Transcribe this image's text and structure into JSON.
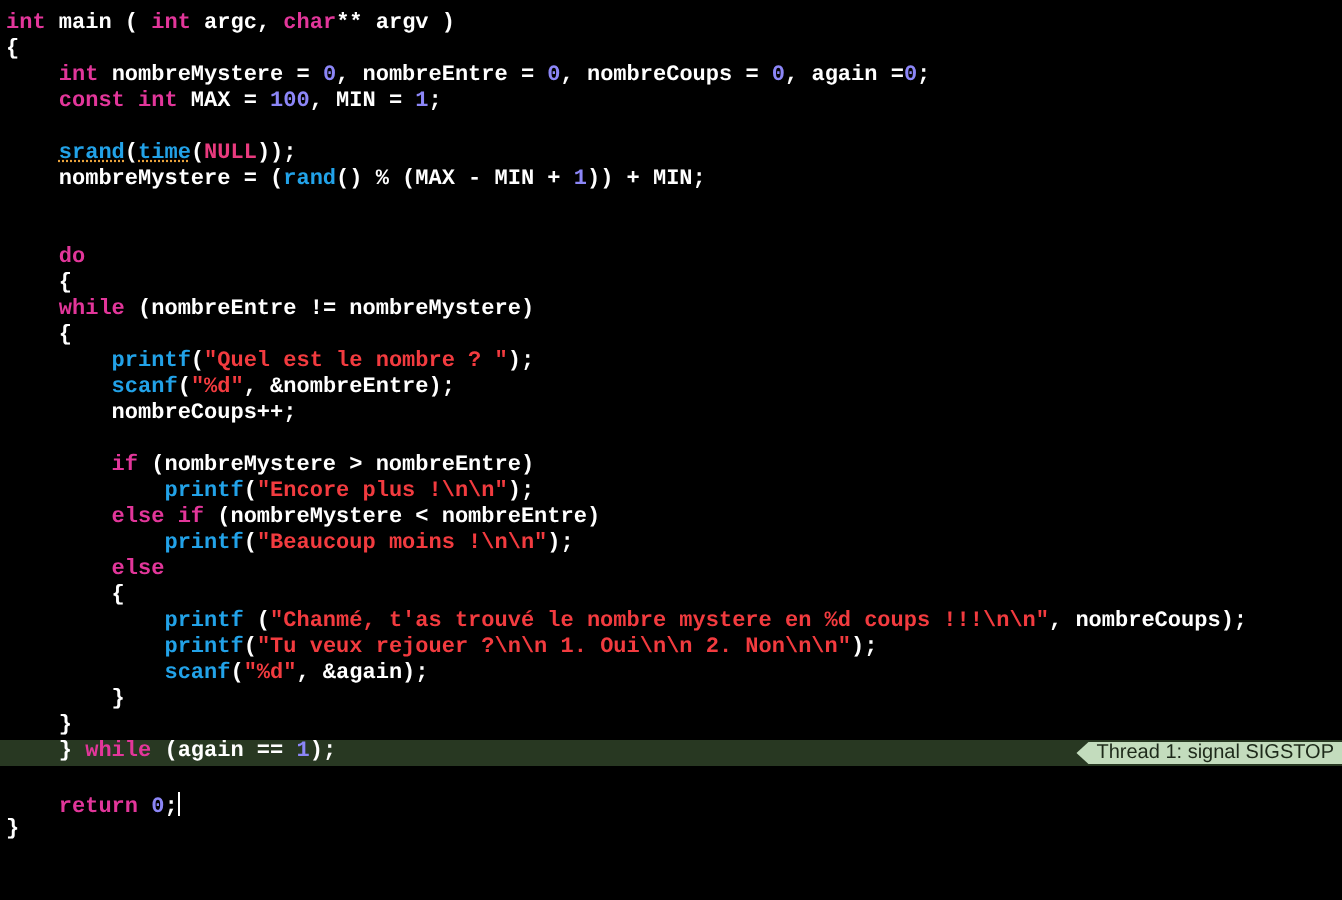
{
  "editor": {
    "lines": [
      {
        "current": false,
        "caret": false,
        "tokens": [
          {
            "kind": "keyword",
            "text": "int"
          },
          {
            "kind": "plain",
            "text": " main ( "
          },
          {
            "kind": "keyword",
            "text": "int"
          },
          {
            "kind": "plain",
            "text": " argc, "
          },
          {
            "kind": "keyword",
            "text": "char"
          },
          {
            "kind": "plain",
            "text": "** argv )"
          }
        ]
      },
      {
        "current": false,
        "caret": false,
        "tokens": [
          {
            "kind": "plain",
            "text": "{"
          }
        ]
      },
      {
        "current": false,
        "caret": false,
        "tokens": [
          {
            "kind": "keyword",
            "text": "    int"
          },
          {
            "kind": "plain",
            "text": " nombreMystere = "
          },
          {
            "kind": "number",
            "text": "0"
          },
          {
            "kind": "plain",
            "text": ", nombreEntre = "
          },
          {
            "kind": "number",
            "text": "0"
          },
          {
            "kind": "plain",
            "text": ", nombreCoups = "
          },
          {
            "kind": "number",
            "text": "0"
          },
          {
            "kind": "plain",
            "text": ", again ="
          },
          {
            "kind": "number",
            "text": "0"
          },
          {
            "kind": "plain",
            "text": ";"
          }
        ]
      },
      {
        "current": false,
        "caret": false,
        "tokens": [
          {
            "kind": "keyword",
            "text": "    const int"
          },
          {
            "kind": "plain",
            "text": " MAX = "
          },
          {
            "kind": "number",
            "text": "100"
          },
          {
            "kind": "plain",
            "text": ", MIN = "
          },
          {
            "kind": "number",
            "text": "1"
          },
          {
            "kind": "plain",
            "text": ";"
          }
        ]
      },
      {
        "current": false,
        "caret": false
      },
      {
        "current": false,
        "caret": false,
        "tokens": [
          {
            "kind": "function",
            "text": "    srand",
            "warning": true
          },
          {
            "kind": "plain",
            "text": "("
          },
          {
            "kind": "function",
            "text": "time",
            "warning": true
          },
          {
            "kind": "plain",
            "text": "("
          },
          {
            "kind": "macro",
            "text": "NULL"
          },
          {
            "kind": "plain",
            "text": "));"
          }
        ]
      },
      {
        "current": false,
        "caret": false,
        "tokens": [
          {
            "kind": "plain",
            "text": "    nombreMystere = ("
          },
          {
            "kind": "function",
            "text": "rand"
          },
          {
            "kind": "plain",
            "text": "() % (MAX - MIN + "
          },
          {
            "kind": "number",
            "text": "1"
          },
          {
            "kind": "plain",
            "text": ")) + MIN;"
          }
        ]
      },
      {
        "current": false,
        "caret": false
      },
      {
        "current": false,
        "caret": false
      },
      {
        "current": false,
        "caret": false,
        "tokens": [
          {
            "kind": "keyword",
            "text": "    do"
          }
        ]
      },
      {
        "current": false,
        "caret": false,
        "tokens": [
          {
            "kind": "plain",
            "text": "    {"
          }
        ]
      },
      {
        "current": false,
        "caret": false,
        "tokens": [
          {
            "kind": "keyword",
            "text": "    while"
          },
          {
            "kind": "plain",
            "text": " (nombreEntre != nombreMystere)"
          }
        ]
      },
      {
        "current": false,
        "caret": false,
        "tokens": [
          {
            "kind": "plain",
            "text": "    {"
          }
        ]
      },
      {
        "current": false,
        "caret": false,
        "tokens": [
          {
            "kind": "function",
            "text": "        printf"
          },
          {
            "kind": "plain",
            "text": "("
          },
          {
            "kind": "string",
            "text": "\"Quel est le nombre ? \""
          },
          {
            "kind": "plain",
            "text": ");"
          }
        ]
      },
      {
        "current": false,
        "caret": false,
        "tokens": [
          {
            "kind": "function",
            "text": "        scanf"
          },
          {
            "kind": "plain",
            "text": "("
          },
          {
            "kind": "string",
            "text": "\"%d\""
          },
          {
            "kind": "plain",
            "text": ", &nombreEntre);"
          }
        ]
      },
      {
        "current": false,
        "caret": false,
        "tokens": [
          {
            "kind": "plain",
            "text": "        nombreCoups++;"
          }
        ]
      },
      {
        "current": false,
        "caret": false
      },
      {
        "current": false,
        "caret": false,
        "tokens": [
          {
            "kind": "keyword",
            "text": "        if"
          },
          {
            "kind": "plain",
            "text": " (nombreMystere > nombreEntre)"
          }
        ]
      },
      {
        "current": false,
        "caret": false,
        "tokens": [
          {
            "kind": "function",
            "text": "            printf"
          },
          {
            "kind": "plain",
            "text": "("
          },
          {
            "kind": "string",
            "text": "\"Encore plus !\\n\\n\""
          },
          {
            "kind": "plain",
            "text": ");"
          }
        ]
      },
      {
        "current": false,
        "caret": false,
        "tokens": [
          {
            "kind": "keyword",
            "text": "        else if"
          },
          {
            "kind": "plain",
            "text": " (nombreMystere < nombreEntre)"
          }
        ]
      },
      {
        "current": false,
        "caret": false,
        "tokens": [
          {
            "kind": "function",
            "text": "            printf"
          },
          {
            "kind": "plain",
            "text": "("
          },
          {
            "kind": "string",
            "text": "\"Beaucoup moins !\\n\\n\""
          },
          {
            "kind": "plain",
            "text": ");"
          }
        ]
      },
      {
        "current": false,
        "caret": false,
        "tokens": [
          {
            "kind": "keyword",
            "text": "        else"
          }
        ]
      },
      {
        "current": false,
        "caret": false,
        "tokens": [
          {
            "kind": "plain",
            "text": "        {"
          }
        ]
      },
      {
        "current": false,
        "caret": false,
        "tokens": [
          {
            "kind": "function",
            "text": "            printf"
          },
          {
            "kind": "plain",
            "text": " ("
          },
          {
            "kind": "string",
            "text": "\"Chanmé, t'as trouvé le nombre mystere en %d coups !!!\\n\\n\""
          },
          {
            "kind": "plain",
            "text": ", nombreCoups);"
          }
        ]
      },
      {
        "current": false,
        "caret": false,
        "tokens": [
          {
            "kind": "function",
            "text": "            printf"
          },
          {
            "kind": "plain",
            "text": "("
          },
          {
            "kind": "string",
            "text": "\"Tu veux rejouer ?\\n\\n 1. Oui\\n\\n 2. Non\\n\\n\""
          },
          {
            "kind": "plain",
            "text": ");"
          }
        ]
      },
      {
        "current": false,
        "caret": false,
        "tokens": [
          {
            "kind": "function",
            "text": "            scanf"
          },
          {
            "kind": "plain",
            "text": "("
          },
          {
            "kind": "string",
            "text": "\"%d\""
          },
          {
            "kind": "plain",
            "text": ", &again);"
          }
        ]
      },
      {
        "current": false,
        "caret": false,
        "tokens": [
          {
            "kind": "plain",
            "text": "        }"
          }
        ]
      },
      {
        "current": false,
        "caret": false,
        "tokens": [
          {
            "kind": "plain",
            "text": "    }"
          }
        ]
      },
      {
        "current": true,
        "caret": false,
        "badge": "Thread 1: signal SIGSTOP",
        "tokens": [
          {
            "kind": "plain",
            "text": "    } "
          },
          {
            "kind": "keyword",
            "text": "while"
          },
          {
            "kind": "plain",
            "text": " (again == "
          },
          {
            "kind": "number",
            "text": "1"
          },
          {
            "kind": "plain",
            "text": ");"
          }
        ]
      },
      {
        "current": false,
        "caret": false
      },
      {
        "current": false,
        "caret": true,
        "tokens": [
          {
            "kind": "keyword",
            "text": "    return "
          },
          {
            "kind": "number",
            "text": "0"
          },
          {
            "kind": "plain",
            "text": ";"
          }
        ]
      },
      {
        "current": false,
        "caret": false,
        "tokens": [
          {
            "kind": "plain",
            "text": "}"
          }
        ]
      }
    ]
  }
}
